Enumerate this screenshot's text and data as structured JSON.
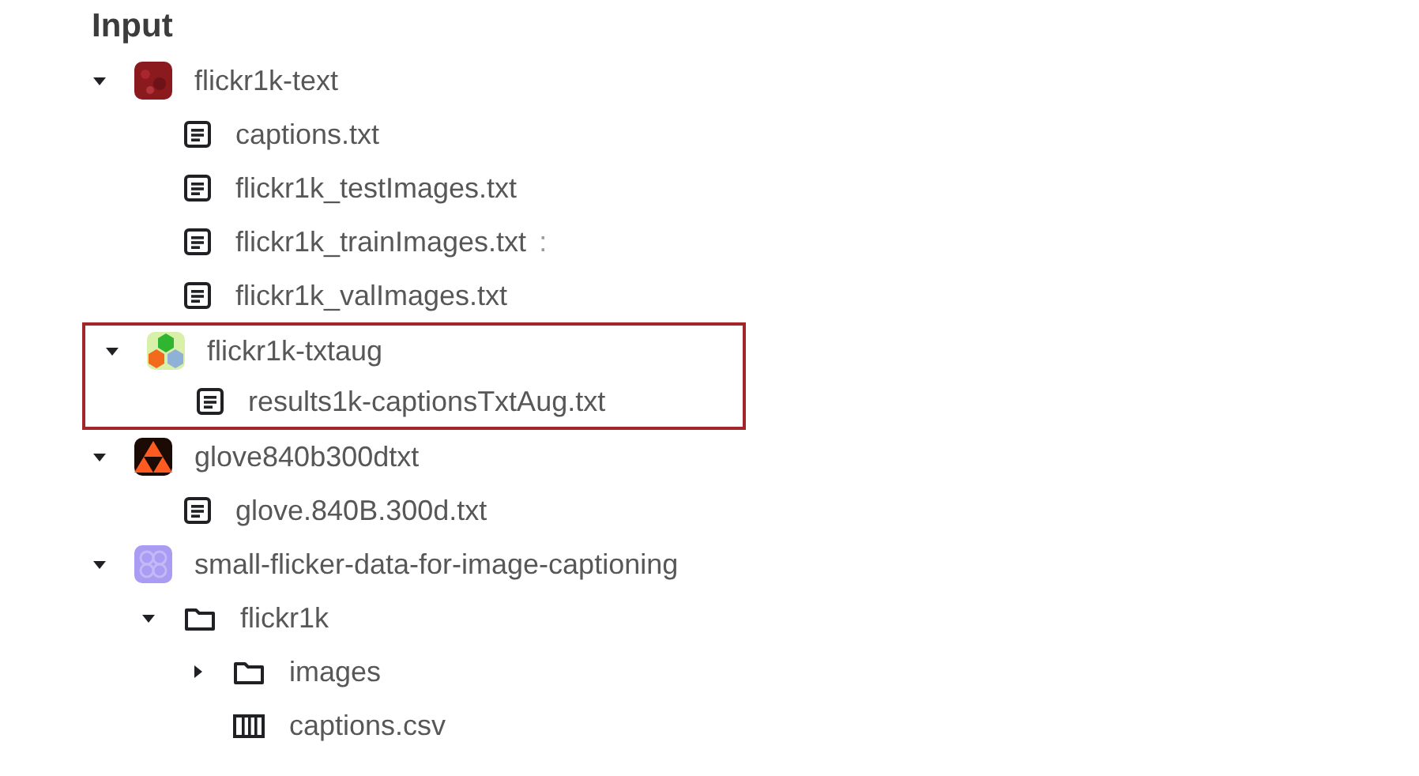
{
  "panel": {
    "title": "Input"
  },
  "tree": {
    "items": [
      {
        "kind": "dataset",
        "label": "flickr1k-text",
        "expanded": true,
        "highlighted": false,
        "children": [
          {
            "kind": "file",
            "label": "captions.txt"
          },
          {
            "kind": "file",
            "label": "flickr1k_testImages.txt"
          },
          {
            "kind": "file",
            "label": "flickr1k_trainImages.txt",
            "menu": ":"
          },
          {
            "kind": "file",
            "label": "flickr1k_valImages.txt"
          }
        ]
      },
      {
        "kind": "dataset",
        "label": "flickr1k-txtaug",
        "expanded": true,
        "highlighted": true,
        "children": [
          {
            "kind": "file",
            "label": "results1k-captionsTxtAug.txt"
          }
        ]
      },
      {
        "kind": "dataset",
        "label": "glove840b300dtxt",
        "expanded": true,
        "highlighted": false,
        "children": [
          {
            "kind": "file",
            "label": "glove.840B.300d.txt"
          }
        ]
      },
      {
        "kind": "dataset",
        "label": "small-flicker-data-for-image-captioning",
        "expanded": true,
        "highlighted": false,
        "children": [
          {
            "kind": "folder",
            "label": "flickr1k",
            "expanded": true,
            "children": [
              {
                "kind": "folder",
                "label": "images",
                "expanded": false
              },
              {
                "kind": "table",
                "label": "captions.csv"
              }
            ]
          }
        ]
      }
    ]
  }
}
